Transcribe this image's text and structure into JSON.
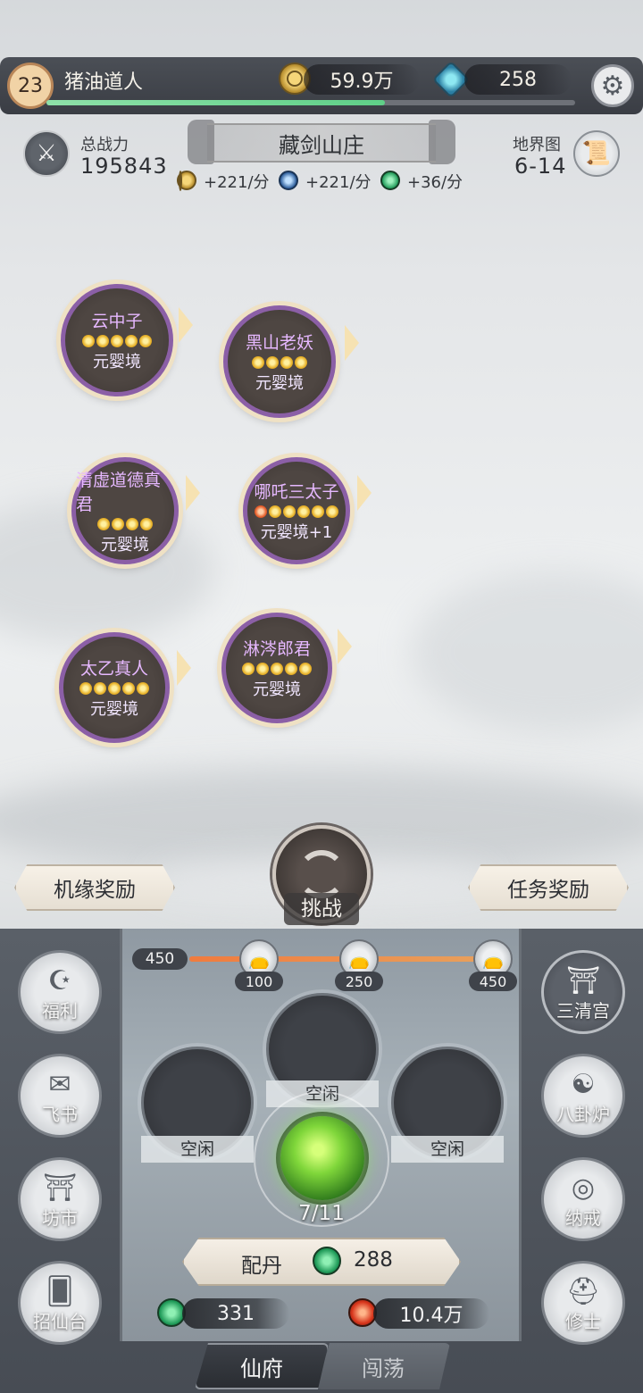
{
  "player": {
    "level": "23",
    "name": "猪油道人",
    "xp_fraction": 0.64
  },
  "resources": {
    "coins": "59.9万",
    "crystals": "258"
  },
  "stats": {
    "power_label": "总战力",
    "power_value": "195843",
    "map_label": "地界图",
    "map_value": "6-14"
  },
  "location": {
    "name": "藏剑山庄"
  },
  "rates": [
    {
      "text": "+221/分"
    },
    {
      "text": "+221/分"
    },
    {
      "text": "+36/分"
    }
  ],
  "bosses": [
    {
      "name": "云中子",
      "realm": "元婴境",
      "stars": 5,
      "red_stars": 0
    },
    {
      "name": "黑山老妖",
      "realm": "元婴境",
      "stars": 4,
      "red_stars": 0
    },
    {
      "name": "清虚道德真君",
      "realm": "元婴境",
      "stars": 4,
      "red_stars": 0
    },
    {
      "name": "哪吒三太子",
      "realm": "元婴境+1",
      "stars": 6,
      "red_stars": 1
    },
    {
      "name": "太乙真人",
      "realm": "元婴境",
      "stars": 5,
      "red_stars": 0
    },
    {
      "name": "淋涔郎君",
      "realm": "元婴境",
      "stars": 5,
      "red_stars": 0
    }
  ],
  "banners": {
    "left": "机缘奖励",
    "right": "任务奖励"
  },
  "challenge": {
    "label": "挑战"
  },
  "side_left": [
    {
      "label": "福利"
    },
    {
      "label": "飞书"
    },
    {
      "label": "坊市"
    },
    {
      "label": "招仙台"
    }
  ],
  "side_right": [
    {
      "label": "三清宫"
    },
    {
      "label": "八卦炉"
    },
    {
      "label": "纳戒"
    },
    {
      "label": "修士"
    }
  ],
  "progress": {
    "current": "450",
    "milestones": [
      "100",
      "250",
      "450"
    ]
  },
  "slots": {
    "top": "空闲",
    "left": "空闲",
    "right": "空闲"
  },
  "furnace": {
    "count": "7/11"
  },
  "pill": {
    "label": "配丹",
    "cost": "288"
  },
  "currencies": {
    "green": "331",
    "red": "10.4万"
  },
  "tabs": {
    "active": "仙府",
    "inactive": "闯荡"
  },
  "colors": {
    "boss_border": "#8b5fa6",
    "boss_name": "#e6b8ff",
    "xp": "#5fcf88"
  }
}
